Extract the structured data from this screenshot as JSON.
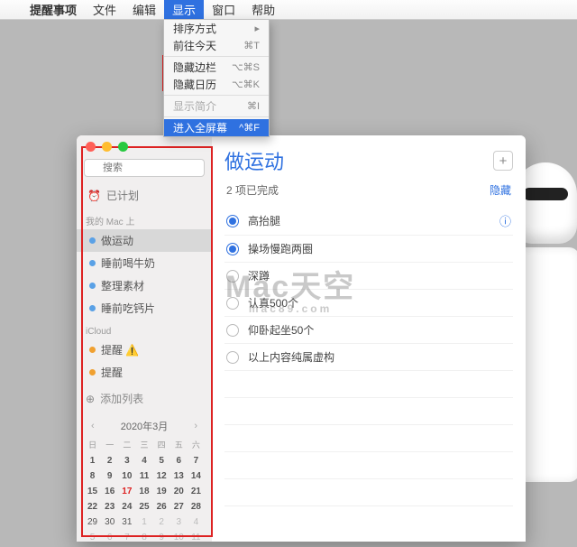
{
  "menubar": {
    "app": "提醒事项",
    "items": [
      "文件",
      "编辑",
      "显示",
      "窗口",
      "帮助"
    ],
    "active_index": 2
  },
  "dropdown": {
    "items": [
      {
        "label": "排序方式",
        "shortcut": "",
        "disabled": false,
        "arrow": "▸"
      },
      {
        "label": "前往今天",
        "shortcut": "⌘T",
        "disabled": false
      },
      {
        "sep": true
      },
      {
        "label": "隐藏边栏",
        "shortcut": "⌥⌘S",
        "disabled": false
      },
      {
        "label": "隐藏日历",
        "shortcut": "⌥⌘K",
        "disabled": false
      },
      {
        "sep": true
      },
      {
        "label": "显示简介",
        "shortcut": "⌘I",
        "disabled": true
      },
      {
        "sep": true
      },
      {
        "label": "进入全屏幕",
        "shortcut": "^⌘F",
        "disabled": false,
        "highlight": true
      }
    ]
  },
  "sidebar": {
    "search_placeholder": "搜索",
    "scheduled_label": "已计划",
    "sections": [
      {
        "title": "我的 Mac 上",
        "items": [
          "做运动",
          "睡前喝牛奶",
          "整理素材",
          "睡前吃钙片"
        ],
        "selected": 0
      },
      {
        "title": "iCloud",
        "items": [
          "提醒 ⚠️",
          "提醒"
        ]
      }
    ],
    "add_list": "添加列表"
  },
  "calendar": {
    "title": "2020年3月",
    "dow": [
      "日",
      "一",
      "二",
      "三",
      "四",
      "五",
      "六"
    ],
    "weeks": [
      [
        1,
        2,
        3,
        4,
        5,
        6,
        7
      ],
      [
        8,
        9,
        10,
        11,
        12,
        13,
        14
      ],
      [
        15,
        16,
        "17",
        18,
        19,
        20,
        21
      ],
      [
        22,
        23,
        24,
        25,
        26,
        27,
        28
      ],
      [
        29,
        30,
        31,
        1,
        2,
        3,
        4
      ],
      [
        5,
        6,
        7,
        8,
        9,
        10,
        11
      ]
    ],
    "today": 17,
    "dim_from_row": 4
  },
  "main": {
    "title": "做运动",
    "completed_count": "2",
    "completed_suffix": "项已完成",
    "hide": "隐藏",
    "tasks": [
      {
        "label": "高抬腿",
        "done": true,
        "info": true
      },
      {
        "label": "操场慢跑两圈",
        "done": true
      },
      {
        "label": "深蹲",
        "done": false
      },
      {
        "label": "认真500个",
        "done": false
      },
      {
        "label": "仰卧起坐50个",
        "done": false
      },
      {
        "label": "以上内容纯属虚构",
        "done": false
      }
    ]
  },
  "watermark": {
    "main": "Mac天空",
    "sub": "mac89.com"
  }
}
